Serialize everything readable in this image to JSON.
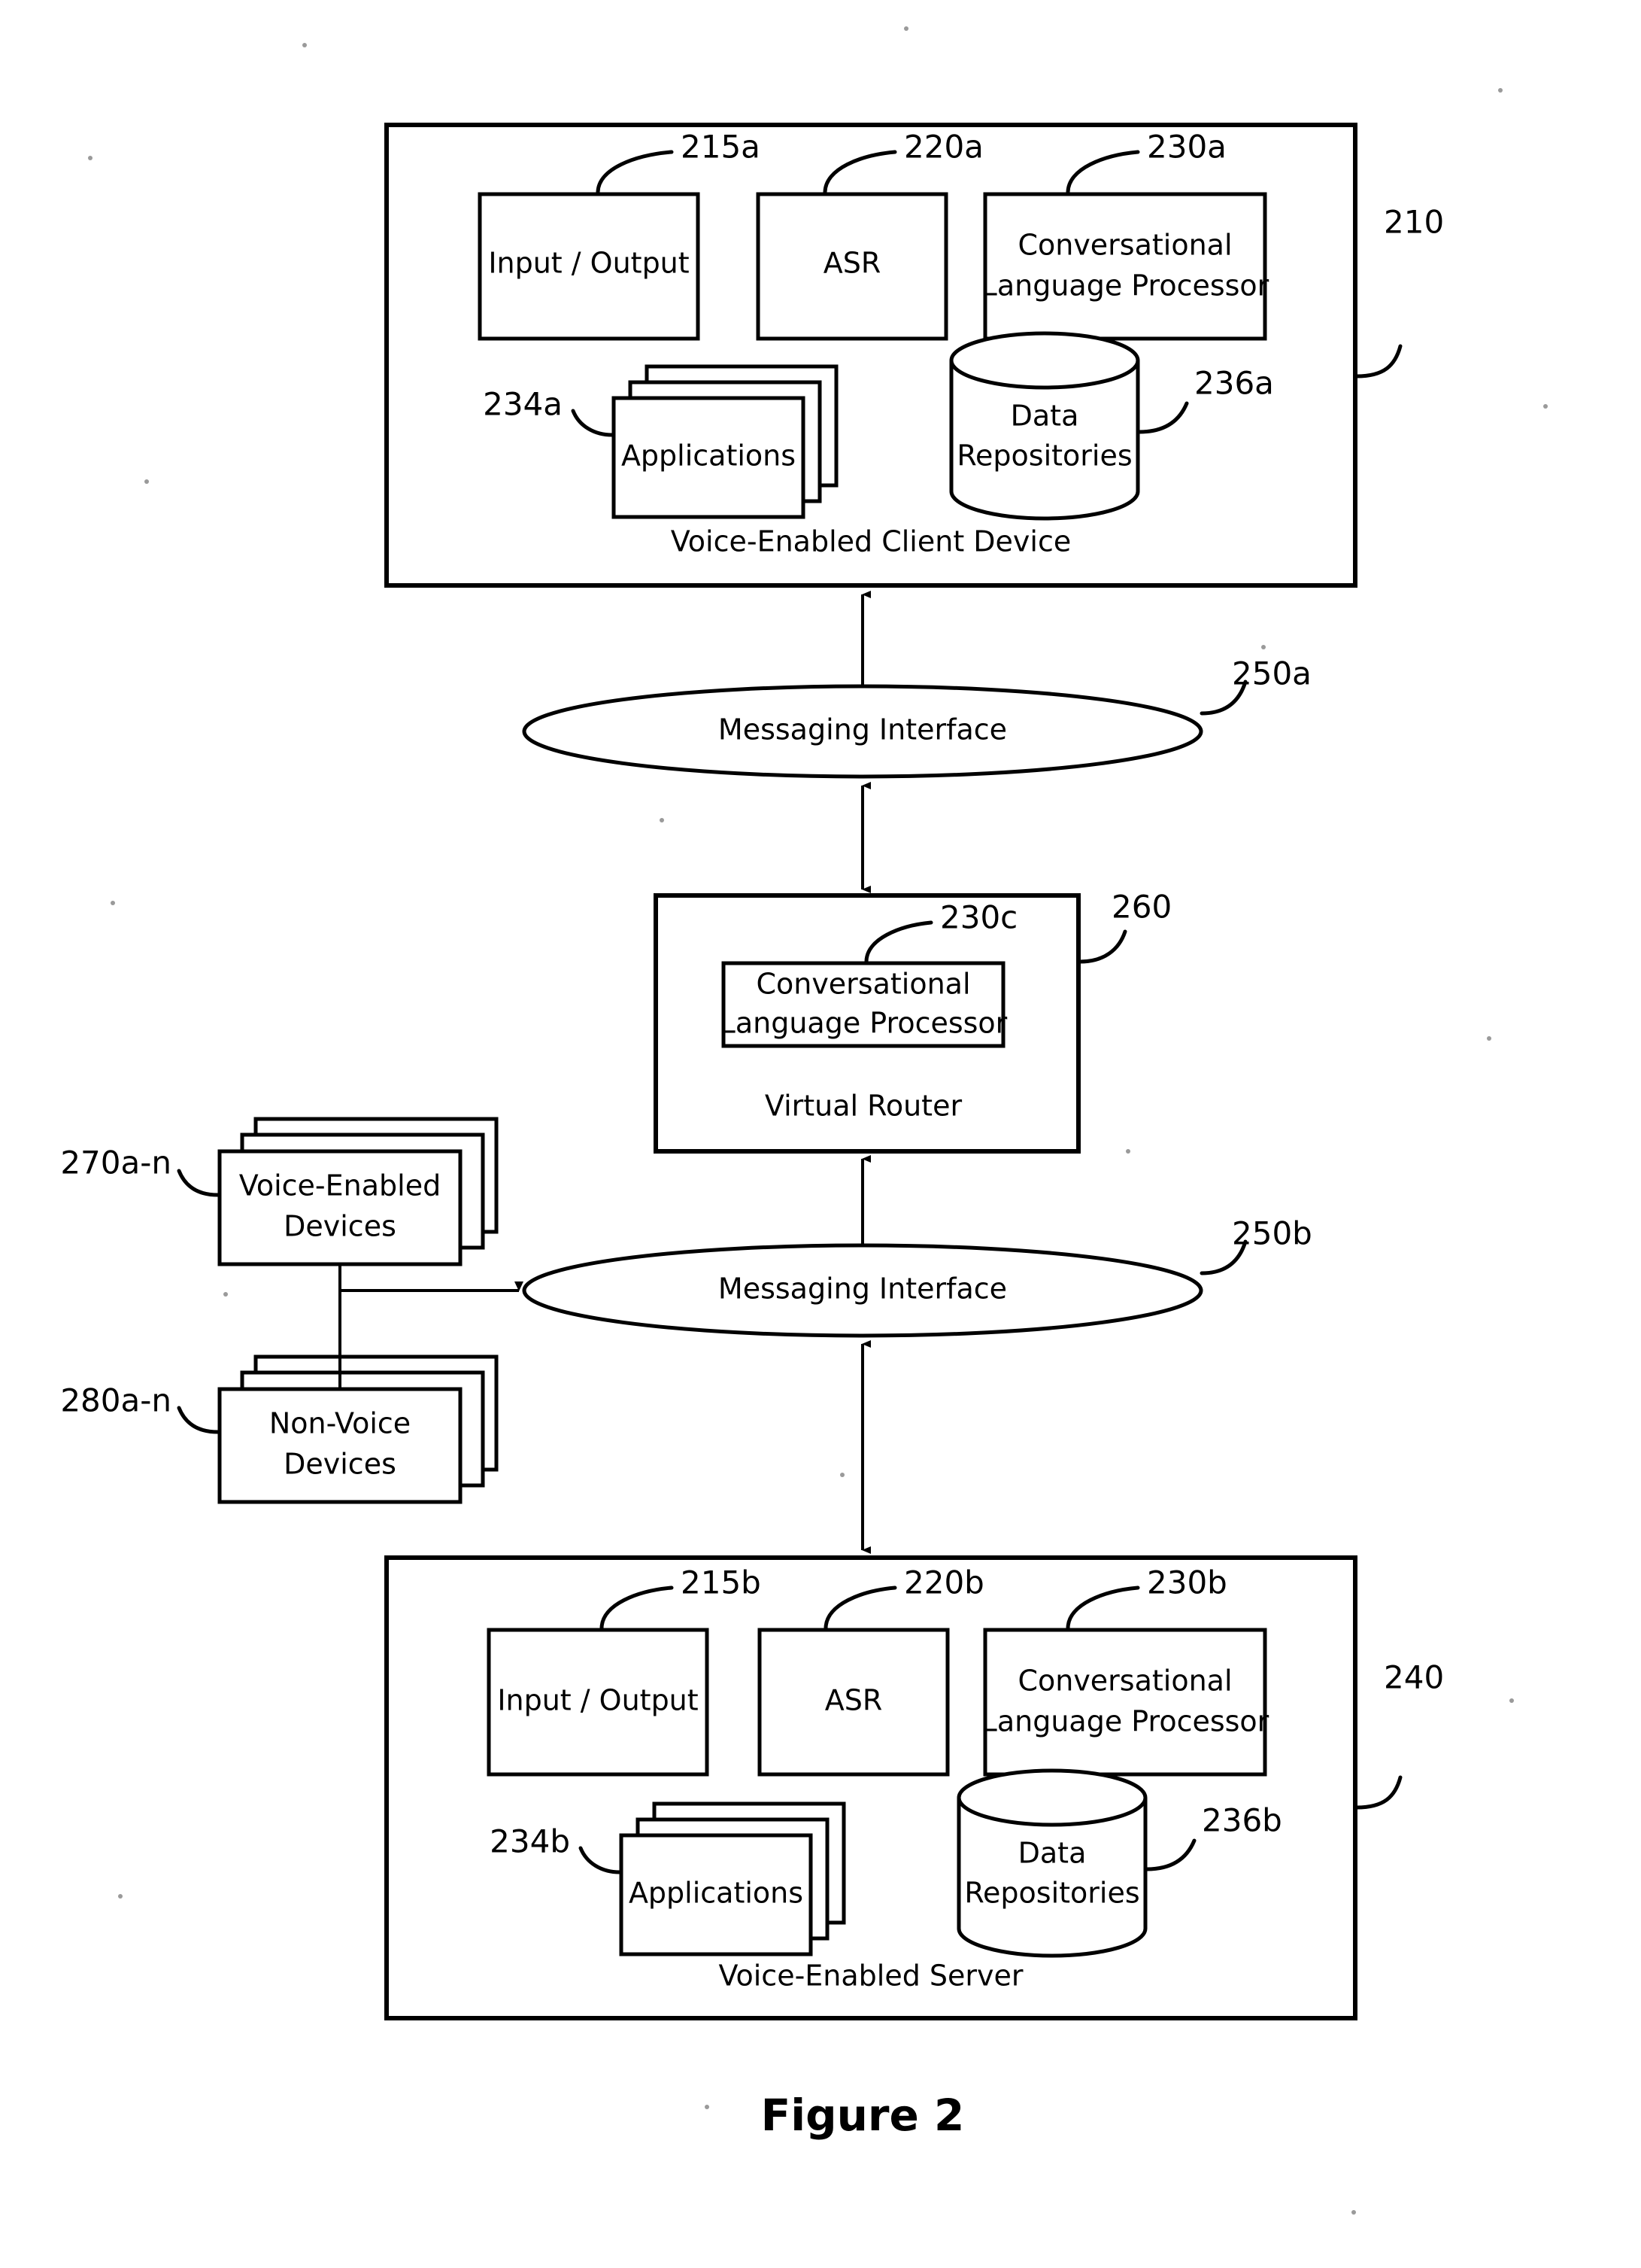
{
  "figure": {
    "caption": "Figure 2"
  },
  "client_device": {
    "ref": "210",
    "panel_label": "Voice-Enabled Client Device",
    "components": [
      {
        "label": "Input / Output",
        "ref": "215a",
        "shape": "rect"
      },
      {
        "label": "ASR",
        "ref": "220a",
        "shape": "rect"
      },
      {
        "label_line1": "Conversational",
        "label_line2": "Language Processor",
        "ref": "230a",
        "shape": "rect"
      },
      {
        "label": "Applications",
        "ref": "234a",
        "shape": "stacked-rect"
      },
      {
        "label_line1": "Data",
        "label_line2": "Repositories",
        "ref": "236a",
        "shape": "cylinder"
      }
    ]
  },
  "messaging_interface_top": {
    "label": "Messaging Interface",
    "ref": "250a"
  },
  "virtual_router": {
    "ref": "260",
    "panel_label": "Virtual Router",
    "clp": {
      "label_line1": "Conversational",
      "label_line2": "Language Processor",
      "ref": "230c"
    }
  },
  "messaging_interface_bottom": {
    "label": "Messaging Interface",
    "ref": "250b"
  },
  "voice_enabled_devices": {
    "label_line1": "Voice-Enabled",
    "label_line2": "Devices",
    "ref": "270a-n"
  },
  "non_voice_devices": {
    "label_line1": "Non-Voice",
    "label_line2": "Devices",
    "ref": "280a-n"
  },
  "server": {
    "ref": "240",
    "panel_label": "Voice-Enabled Server",
    "components": [
      {
        "label": "Input / Output",
        "ref": "215b",
        "shape": "rect"
      },
      {
        "label": "ASR",
        "ref": "220b",
        "shape": "rect"
      },
      {
        "label_line1": "Conversational",
        "label_line2": "Language Processor",
        "ref": "230b",
        "shape": "rect"
      },
      {
        "label": "Applications",
        "ref": "234b",
        "shape": "stacked-rect"
      },
      {
        "label_line1": "Data",
        "label_line2": "Repositories",
        "ref": "236b",
        "shape": "cylinder"
      }
    ]
  },
  "icons": {
    "arrow": "bidirectional-arrow-icon",
    "cylinder": "database-cylinder-icon",
    "stack": "stacked-documents-icon",
    "ellipse": "ellipse-node-icon"
  }
}
